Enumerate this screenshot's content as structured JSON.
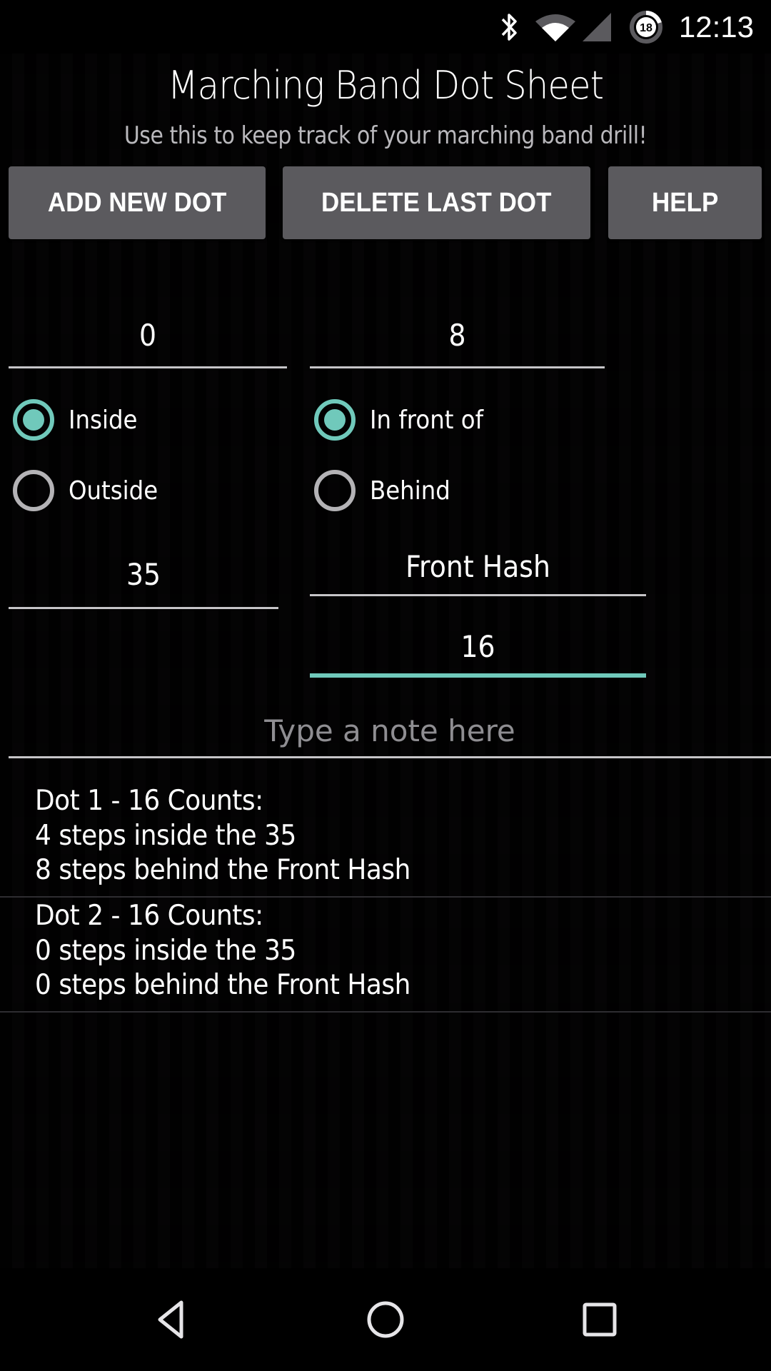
{
  "status_bar": {
    "time": "12:13",
    "icons": [
      "bluetooth-icon",
      "wifi-icon",
      "cell-signal-icon",
      "battery-saver-icon"
    ],
    "battery_badge": "18"
  },
  "header": {
    "title": "Marching Band Dot Sheet",
    "subtitle": "Use this to keep track of your marching band drill!"
  },
  "toolbar": {
    "add_label": "ADD NEW DOT",
    "delete_label": "DELETE LAST DOT",
    "help_label": "HELP"
  },
  "form": {
    "side_steps": "0",
    "front_back_steps": "8",
    "side_options": [
      {
        "label": "Inside",
        "checked": true
      },
      {
        "label": "Outside",
        "checked": false
      }
    ],
    "front_back_options": [
      {
        "label": "In front of",
        "checked": true
      },
      {
        "label": "Behind",
        "checked": false
      }
    ],
    "yard_line": "35",
    "hash": "Front Hash",
    "counts": "16",
    "note_placeholder": "Type a note here",
    "note_value": ""
  },
  "colors": {
    "accent": "#70c9bb",
    "button": "#5b5a5e",
    "background": "#08070a"
  },
  "dots": [
    {
      "header": "Dot 1 - 16 Counts:",
      "line1": "4 steps inside the 35",
      "line2": "8 steps behind the Front Hash"
    },
    {
      "header": "Dot 2 - 16 Counts:",
      "line1": "0 steps inside the 35",
      "line2": "0 steps behind the Front Hash"
    }
  ],
  "nav_bar": {
    "back": "back-icon",
    "home": "home-icon",
    "recents": "recents-icon"
  }
}
